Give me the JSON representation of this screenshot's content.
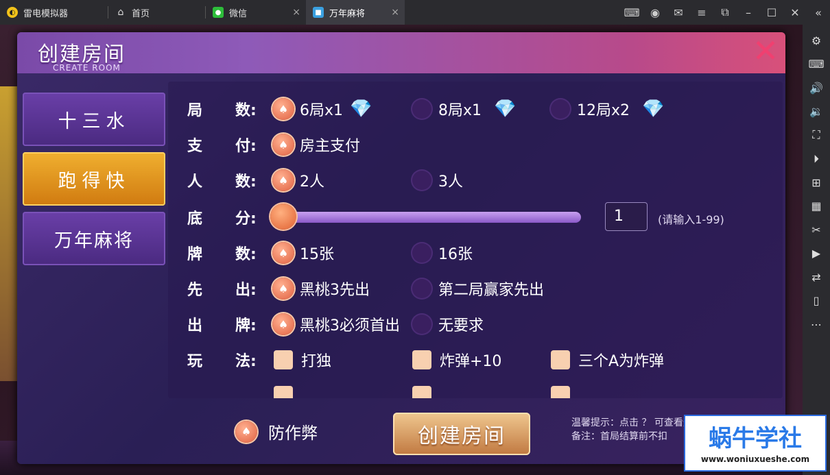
{
  "titlebar": {
    "tabs": [
      {
        "label": "雷电模拟器",
        "icon": "leidian-logo-icon"
      },
      {
        "label": "首页",
        "icon": "home-icon"
      },
      {
        "label": "微信",
        "icon": "wechat-icon"
      },
      {
        "label": "万年麻将",
        "icon": "game-icon"
      }
    ],
    "close_symbol": "×"
  },
  "dialog": {
    "title": "创建房间",
    "subtitle": "CREATE ROOM",
    "close_symbol": "✕"
  },
  "nav": [
    {
      "label": "十三水"
    },
    {
      "label": "跑得快"
    },
    {
      "label": "万年麻将"
    }
  ],
  "rows": {
    "rounds": {
      "label_a": "局",
      "label_b": "数:",
      "options": [
        "6局x1",
        "8局x1",
        "12局x2"
      ]
    },
    "pay": {
      "label_a": "支",
      "label_b": "付:",
      "options": [
        "房主支付"
      ]
    },
    "players": {
      "label_a": "人",
      "label_b": "数:",
      "options": [
        "2人",
        "3人"
      ]
    },
    "base": {
      "label_a": "底",
      "label_b": "分:",
      "value": "1",
      "hint": "(请输入1-99)"
    },
    "cards": {
      "label_a": "牌",
      "label_b": "数:",
      "options": [
        "15张",
        "16张"
      ]
    },
    "first": {
      "label_a": "先",
      "label_b": "出:",
      "options": [
        "黑桃3先出",
        "第二局赢家先出"
      ]
    },
    "play": {
      "label_a": "出",
      "label_b": "牌:",
      "options": [
        "黑桃3必须首出",
        "无要求"
      ]
    },
    "rules": {
      "label_a": "玩",
      "label_b": "法:",
      "options": [
        "打独",
        "炸弹+10",
        "三个A为炸弹"
      ]
    }
  },
  "footer": {
    "anti_cheat": "防作弊",
    "create_button": "创建房间",
    "tip1": "温馨提示：点击 ？ 可查看选项解释",
    "tip2": "备注：首局结算前不扣"
  },
  "watermark": {
    "line1": "蜗牛学社",
    "line2": "www.woniuxueshe.com"
  },
  "colors": {
    "accent": "#f04070",
    "selected_tab": "#f0b030"
  }
}
